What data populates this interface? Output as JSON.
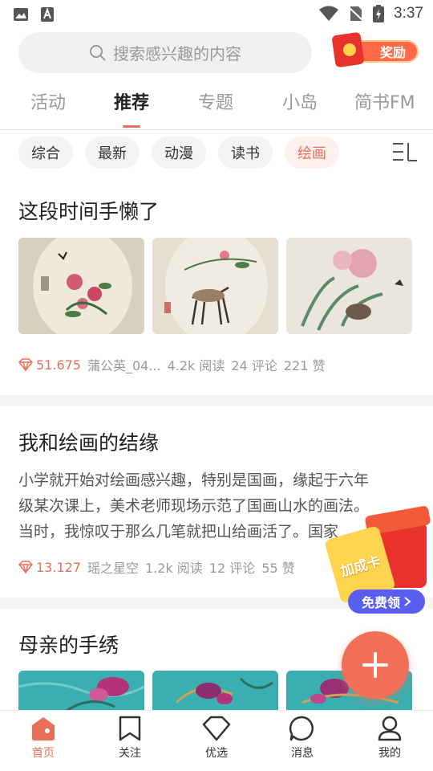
{
  "status_bar": {
    "time": "3:37"
  },
  "search": {
    "placeholder": "搜索感兴趣的内容"
  },
  "reward": {
    "label": "奖励"
  },
  "tabs": [
    {
      "label": "活动"
    },
    {
      "label": "推荐",
      "active": true
    },
    {
      "label": "专题"
    },
    {
      "label": "小岛"
    },
    {
      "label": "简书FM"
    }
  ],
  "chips": [
    {
      "label": "综合"
    },
    {
      "label": "最新"
    },
    {
      "label": "动漫"
    },
    {
      "label": "读书"
    },
    {
      "label": "绘画",
      "active": true
    }
  ],
  "articles": [
    {
      "title": "这段时间手懒了",
      "score": "51.675",
      "author": "蒲公英_04...",
      "reads": "4.2k 阅读",
      "comments": "24 评论",
      "likes": "221 赞"
    },
    {
      "title": "我和绘画的结缘",
      "body_lines": [
        "小学就开始对绘画感兴趣，特别是国画，缘起于六年",
        "级某次课上，美术老师现场示范了国画山水的画法。",
        "当时，我惊叹于那么几笔就把山给画活了。国家"
      ],
      "score": "13.127",
      "author": "瑶之星空",
      "reads": "1.2k 阅读",
      "comments": "12 评论",
      "likes": "55 赞"
    },
    {
      "title": "母亲的手绣"
    }
  ],
  "promo": {
    "card_label": "加成卡",
    "button_label": "免费领"
  },
  "bottom_nav": [
    {
      "label": "首页",
      "active": true
    },
    {
      "label": "关注"
    },
    {
      "label": "优选"
    },
    {
      "label": "消息"
    },
    {
      "label": "我的"
    }
  ],
  "colors": {
    "accent": "#ea6f5a",
    "promo_button": "#5a5ef0"
  }
}
